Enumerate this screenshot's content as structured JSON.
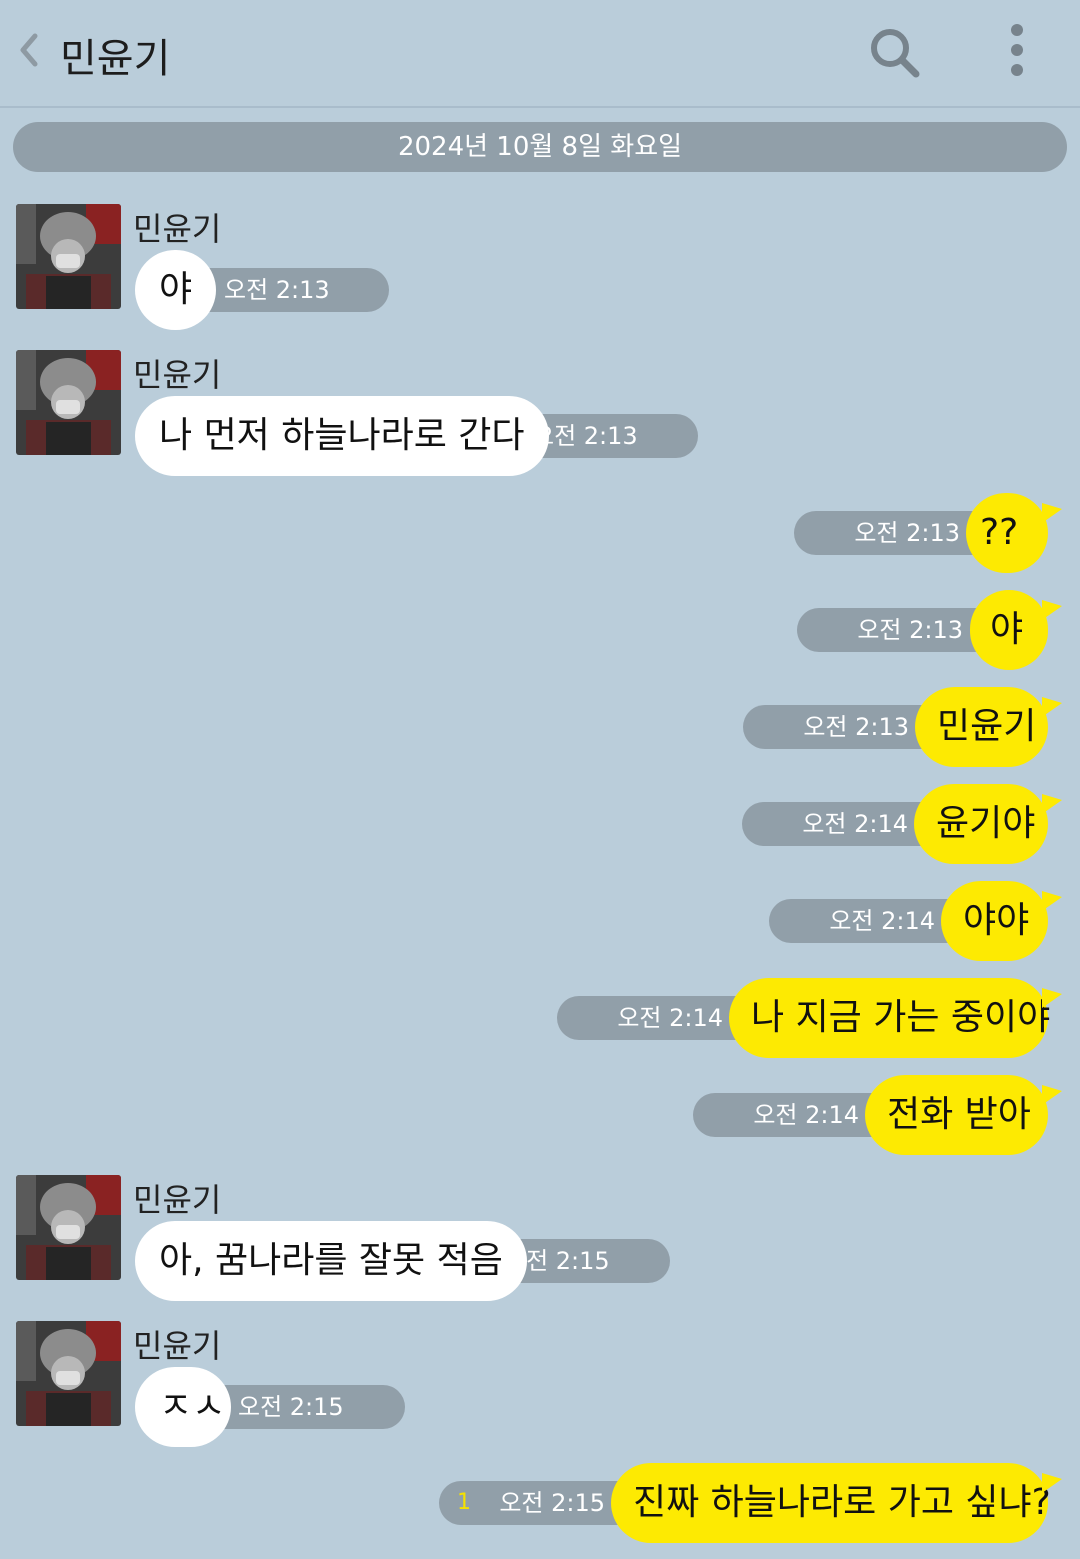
{
  "header": {
    "title": "민윤기",
    "back_icon": "chevron-left-icon",
    "search_icon": "search-icon",
    "more_icon": "more-vertical-icon"
  },
  "date_divider": "2024년 10월 8일 화요일",
  "colors": {
    "background": "#bacdda",
    "sent_bubble": "#fdea02",
    "received_bubble": "#ffffff",
    "time_pill": "#919fa9"
  },
  "messages": [
    {
      "direction": "received",
      "sender": "민윤기",
      "text": "야",
      "time": "오전 2:13"
    },
    {
      "direction": "received",
      "sender": "민윤기",
      "text": "나 먼저 하늘나라로 간다",
      "time": "오전 2:13"
    },
    {
      "direction": "sent",
      "text": "??",
      "time": "오전 2:13"
    },
    {
      "direction": "sent",
      "text": "야",
      "time": "오전 2:13"
    },
    {
      "direction": "sent",
      "text": "민윤기",
      "time": "오전 2:13"
    },
    {
      "direction": "sent",
      "text": "윤기야",
      "time": "오전 2:14"
    },
    {
      "direction": "sent",
      "text": "야야",
      "time": "오전 2:14"
    },
    {
      "direction": "sent",
      "text": "나 지금 가는 중이야",
      "time": "오전 2:14"
    },
    {
      "direction": "sent",
      "text": "전화 받아",
      "time": "오전 2:14"
    },
    {
      "direction": "received",
      "sender": "민윤기",
      "text": "아, 꿈나라를 잘못 적음",
      "time": "오전 2:15"
    },
    {
      "direction": "received",
      "sender": "민윤기",
      "text": "ㅈㅅ",
      "time": "오전 2:15"
    },
    {
      "direction": "sent",
      "text": "진짜 하늘나라로 가고 싶냐?",
      "time": "오전 2:15",
      "unread": "1"
    }
  ]
}
